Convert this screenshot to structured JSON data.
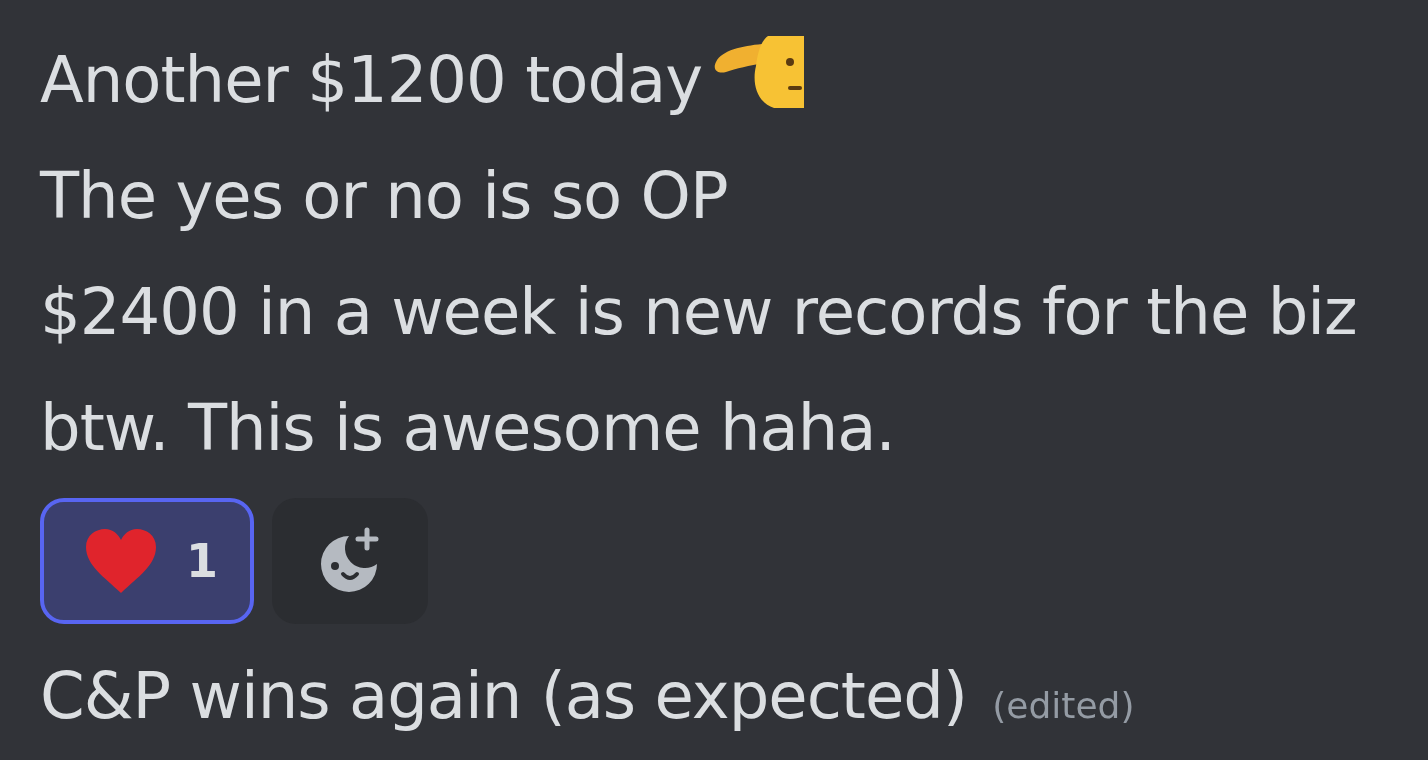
{
  "messages": [
    {
      "text": "Another $1200 today",
      "has_emoji": true,
      "edited": false
    },
    {
      "text": "The yes or no is so OP",
      "has_emoji": false,
      "edited": false
    },
    {
      "text": "$2400 in a week is new records for the biz btw. This is awesome haha.",
      "has_emoji": false,
      "edited": false,
      "reactions": [
        {
          "count": "1",
          "selected": true
        }
      ]
    },
    {
      "text": "C&P wins again (as expected)",
      "has_emoji": false,
      "edited": true,
      "edited_label": "(edited)"
    }
  ]
}
